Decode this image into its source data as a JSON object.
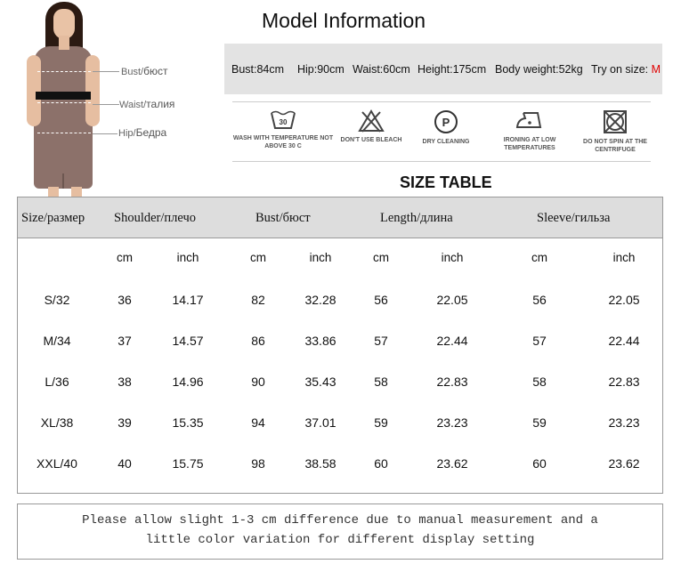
{
  "model_figure": {
    "labels": [
      {
        "en": "Bust/",
        "ru": "бюст"
      },
      {
        "en": "Waist/",
        "ru": "талия"
      },
      {
        "en": "Hip/",
        "ru": "Бедра"
      }
    ]
  },
  "model_info": {
    "title": "Model Information",
    "items": [
      "Bust:84cm",
      "Hip:90cm",
      "Waist:60cm",
      "Height:175cm",
      "Body weight:52kg"
    ],
    "try_on_label": "Try on size:",
    "try_on_size": "M",
    "accent_color": "#e00000"
  },
  "care": [
    {
      "icon": "wash-30-icon",
      "label": "WASH WITH TEMPERATURE NOT ABOVE 30 C",
      "badge": "30"
    },
    {
      "icon": "no-bleach-icon",
      "label": "DON'T USE BLEACH"
    },
    {
      "icon": "dry-cleaning-icon",
      "label": "DRY CLEANING",
      "badge": "P"
    },
    {
      "icon": "iron-low-icon",
      "label": "IRONING AT LOW TEMPERATURES"
    },
    {
      "icon": "no-tumble-dry-icon",
      "label": "DO NOT SPIN AT THE CENTRIFUGE"
    }
  ],
  "size_table": {
    "title": "SIZE TABLE",
    "headers": [
      "Size/размер",
      "Shoulder/плечо",
      "Bust/бюст",
      "Length/длина",
      "Sleeve/гильза"
    ],
    "units": [
      "cm",
      "inch",
      "cm",
      "inch",
      "cm",
      "inch",
      "cm",
      "inch"
    ],
    "rows": [
      [
        "S/32",
        "36",
        "14.17",
        "82",
        "32.28",
        "56",
        "22.05",
        "56",
        "22.05"
      ],
      [
        "M/34",
        "37",
        "14.57",
        "86",
        "33.86",
        "57",
        "22.44",
        "57",
        "22.44"
      ],
      [
        "L/36",
        "38",
        "14.96",
        "90",
        "35.43",
        "58",
        "22.83",
        "58",
        "22.83"
      ],
      [
        "XL/38",
        "39",
        "15.35",
        "94",
        "37.01",
        "59",
        "23.23",
        "59",
        "23.23"
      ],
      [
        "XXL/40",
        "40",
        "15.75",
        "98",
        "38.58",
        "60",
        "23.62",
        "60",
        "23.62"
      ]
    ]
  },
  "note": {
    "line1": "Please allow slight 1-3 cm difference due to manual measurement and a",
    "line2": "little color variation for different display setting"
  }
}
